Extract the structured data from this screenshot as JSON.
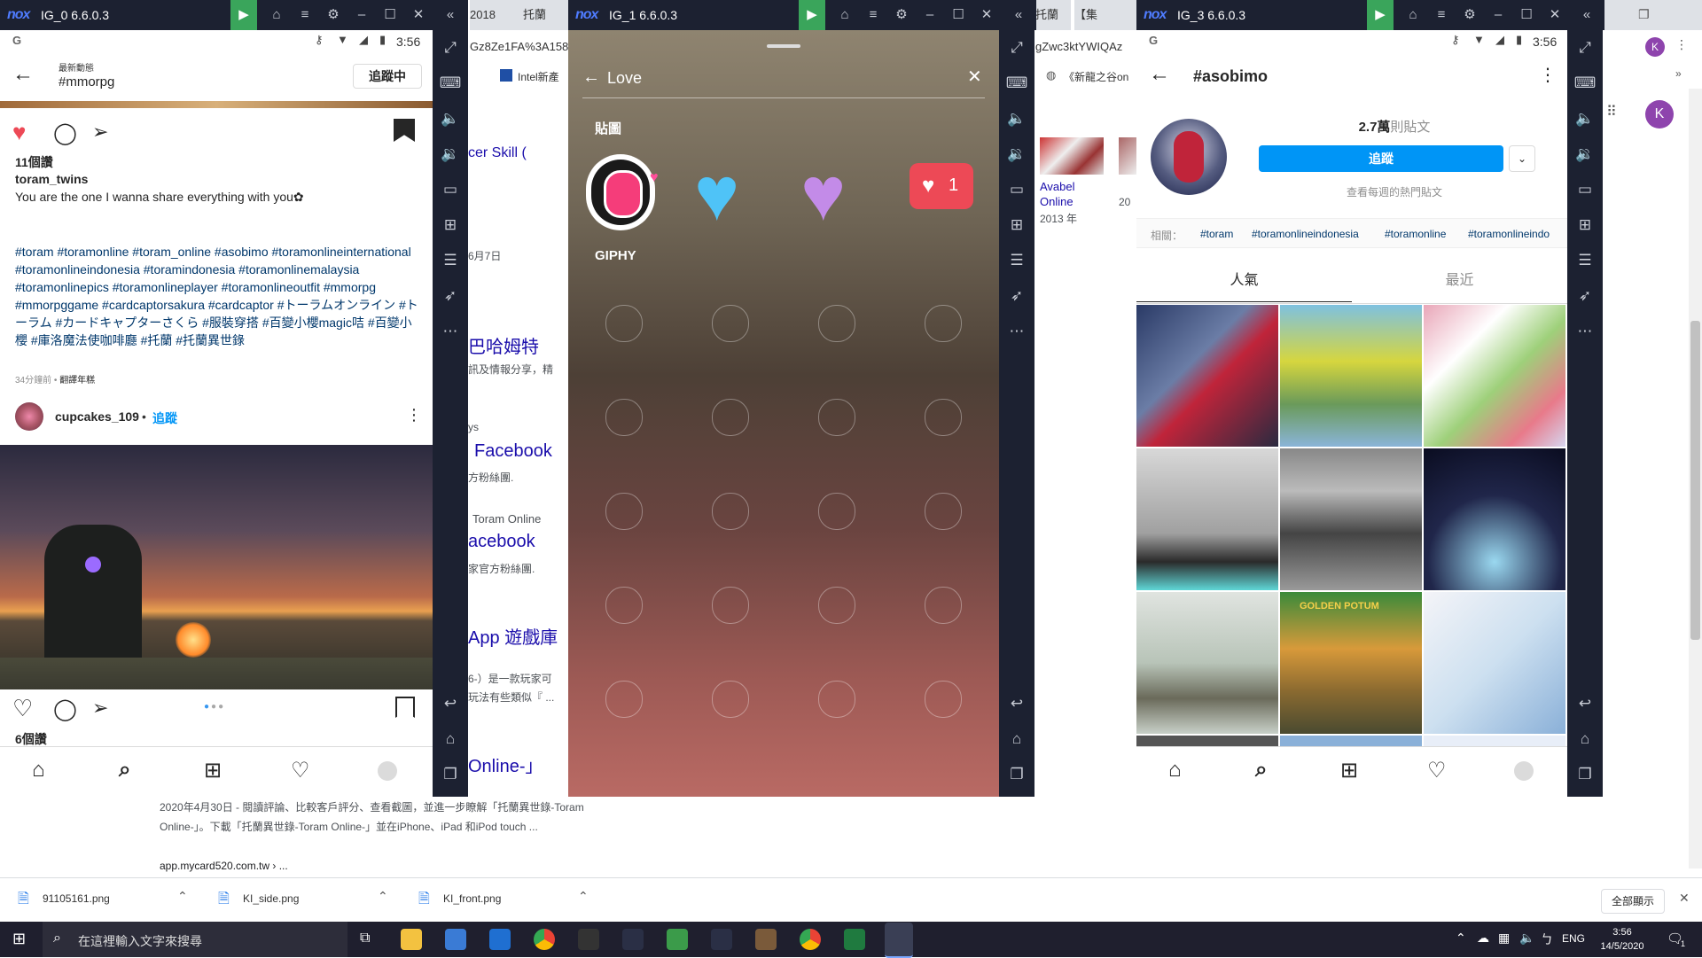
{
  "windows": [
    {
      "title": "IG_0 6.6.0.3"
    },
    {
      "title": "IG_1 6.6.0.3"
    },
    {
      "title": "IG_3 6.6.0.3"
    }
  ],
  "background_browser": {
    "tabs": [
      "2018",
      "托蘭",
      "托蘭",
      "【集"
    ],
    "url_fragment_1": "Gz8Ze1FA%3A158",
    "url_fragment_2": "gZwc3ktYWIQAz",
    "bookmark_1": "Intel新產",
    "bookmark_2": "《新龍之谷on",
    "snippet_skill": "cer Skill (",
    "snippet_date": "6月7日",
    "link_bahamut": "巴哈姆特",
    "snippet_bahamut": "訊及情報分享，精",
    "snippet_ys": "ys",
    "link_facebook_1": "Facebook",
    "snippet_fans_1": "方粉絲團.",
    "snippet_toram": "Toram Online",
    "link_facebook_2": "acebook",
    "snippet_fans_2": "家官方粉絲團.",
    "link_appstore": "App 遊戲庫",
    "snippet_app_1": "6-）是一款玩家可",
    "snippet_app_2": "玩法有些類似『 ...",
    "link_online": "Online-」",
    "avabel_title": "Avabel Online",
    "avabel_year": "2013 年",
    "snippet_20": "20",
    "snippet_bottom_1": "2020年4月30日 - 閱讀評論、比較客戶評分、查看截圖，並進一步瞭解「托蘭異世錄-Toram",
    "snippet_bottom_2": "Online-」。下載「托蘭異世錄-Toram Online-」並在iPhone、iPad 和iPod touch ...",
    "snippet_bottom_url": "app.mycard520.com.tw › ...",
    "profile_initial": "K"
  },
  "ig0": {
    "status_time": "3:56",
    "header_small": "最新動態",
    "header_tag": "#mmorpg",
    "following_button": "追蹤中",
    "likes": "11個讚",
    "username": "toram_twins",
    "caption": "You are the one I wanna share everything with you✿",
    "hashtags": "#toram #toramonline #toram_online #asobimo #toramonlineinternational #toramonlineindonesia #toramindonesia #toramonlinemalaysia #toramonlinepics #toramonlineplayer #toramonlineoutfit #mmorpg #mmorpggame #cardcaptorsakura #cardcaptor #トーラムオンライン #トーラム #カードキャプターさくら #服裝穿搭 #百變小櫻magic咭 #百變小櫻 #庫洛魔法使咖啡廳 #托蘭 #托蘭異世錄",
    "time_ago": "34分鐘前",
    "translate": "翻譯年糕",
    "user2": "cupcakes_109",
    "follow_link": "追蹤",
    "likes2": "6個讚"
  },
  "ig1": {
    "search_value": "Love",
    "stickers_label": "貼圖",
    "giphy_label": "GIPHY",
    "like_count": "1"
  },
  "ig3": {
    "status_time": "3:56",
    "title": "#asobimo",
    "posts_count": "2.7萬",
    "posts_label": "則貼文",
    "follow_button": "追蹤",
    "top_posts_hint": "查看每週的熱門貼文",
    "related_label": "相關：",
    "related_tags": [
      "#toram",
      "#toramonlineindonesia",
      "#toramonline",
      "#toramonlineindo"
    ],
    "tab_top": "人氣",
    "tab_recent": "最近",
    "golden_text": "GOLDEN POTUM"
  },
  "downloads": [
    {
      "name": "91105161.png"
    },
    {
      "name": "KI_side.png"
    },
    {
      "name": "KI_front.png"
    }
  ],
  "download_show_all": "全部顯示",
  "taskbar": {
    "search_placeholder": "在這裡輸入文字來搜尋",
    "lang": "ENG",
    "time": "3:56",
    "date": "14/5/2020",
    "notify_count": "1"
  }
}
